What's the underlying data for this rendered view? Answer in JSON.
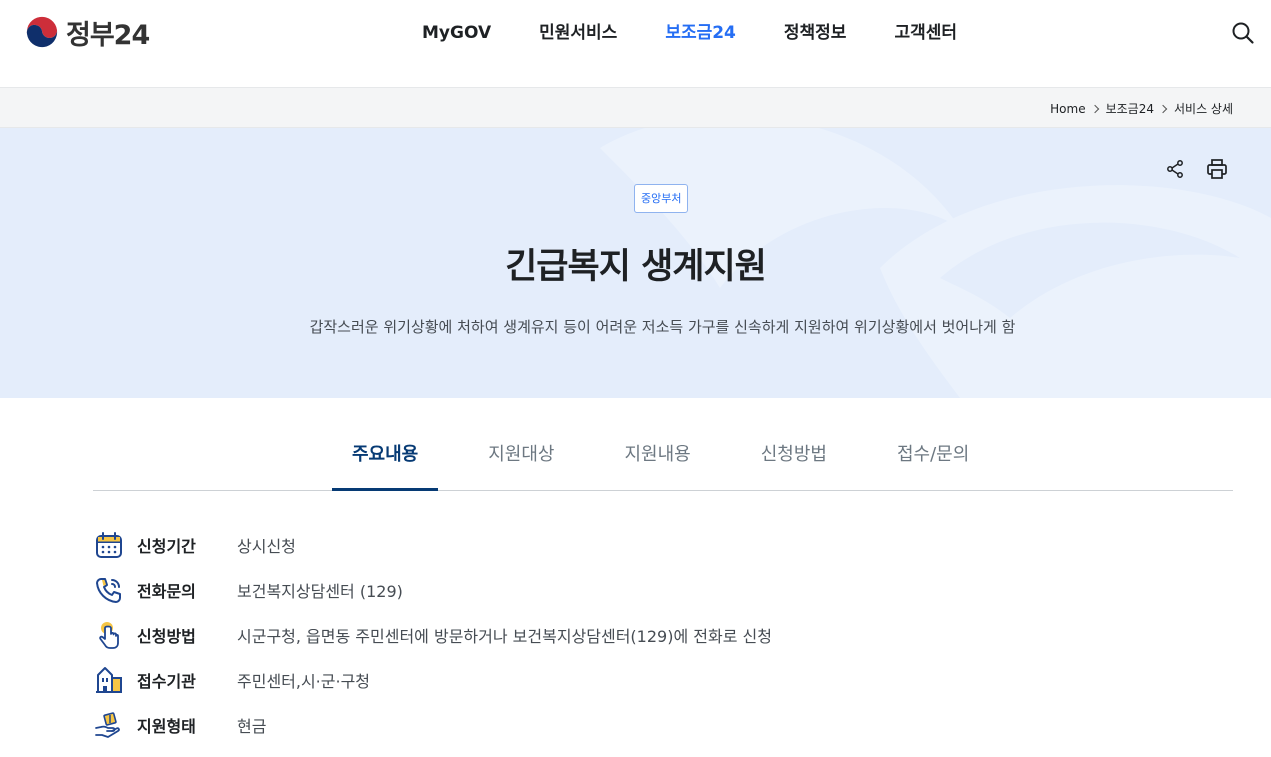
{
  "header": {
    "logo_text": "정부24",
    "nav": [
      "MyGOV",
      "민원서비스",
      "보조금24",
      "정책정보",
      "고객센터"
    ],
    "active_nav": "보조금24"
  },
  "breadcrumb": [
    "Home",
    "보조금24",
    "서비스 상세"
  ],
  "hero": {
    "badge": "중앙부처",
    "title": "긴급복지 생계지원",
    "description": "갑작스러운 위기상황에 처하여 생계유지 등이 어려운 저소득 가구를 신속하게 지원하여 위기상황에서 벗어나게 함"
  },
  "tabs": [
    "주요내용",
    "지원대상",
    "지원내용",
    "신청방법",
    "접수/문의"
  ],
  "active_tab": "주요내용",
  "info": [
    {
      "label": "신청기간",
      "value": "상시신청",
      "icon": "calendar-icon"
    },
    {
      "label": "전화문의",
      "value": "보건복지상담센터 (129)",
      "icon": "phone-icon"
    },
    {
      "label": "신청방법",
      "value": "시군구청, 읍면동 주민센터에 방문하거나 보건복지상담센터(129)에 전화로 신청",
      "icon": "hand-pointer-icon"
    },
    {
      "label": "접수기관",
      "value": "주민센터,시·군·구청",
      "icon": "building-icon"
    },
    {
      "label": "지원형태",
      "value": "현금",
      "icon": "hand-money-icon"
    }
  ],
  "colors": {
    "accent": "#256ef4",
    "navy": "#063a74",
    "hero_bg": "#e4edfb",
    "icon_blue": "#1f4690",
    "icon_yellow": "#f6c544"
  }
}
